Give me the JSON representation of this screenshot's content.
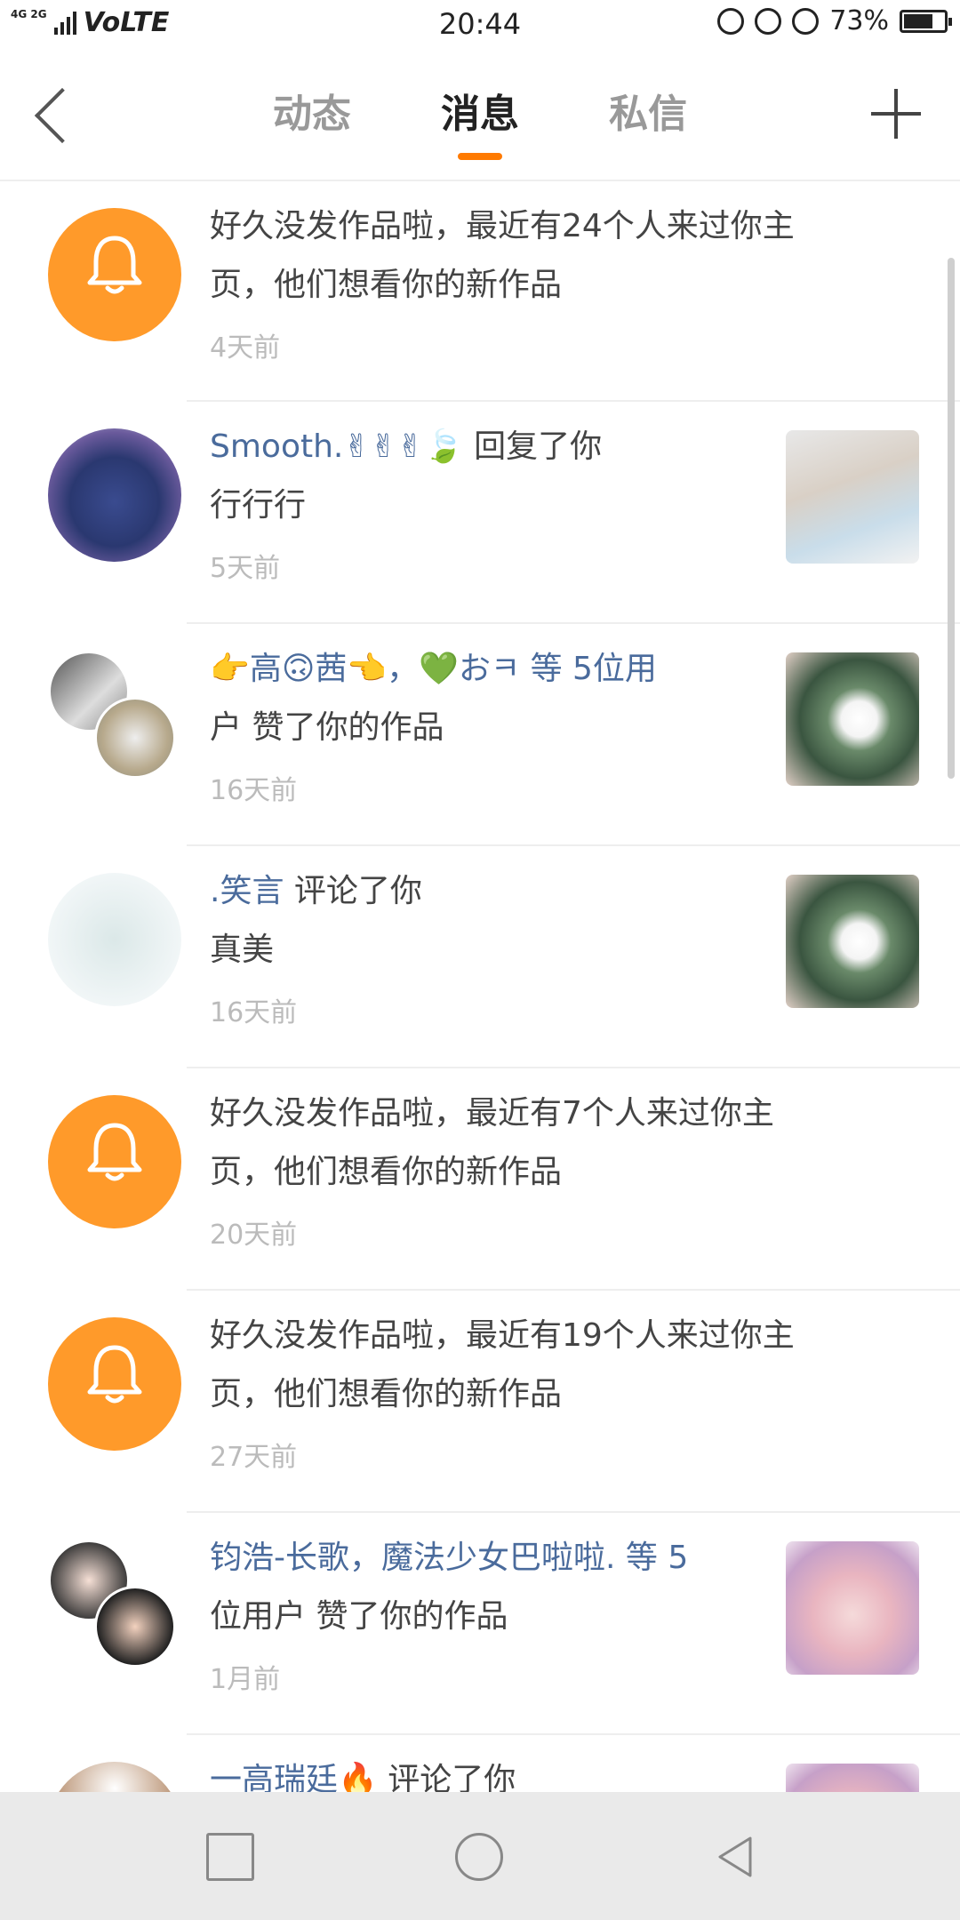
{
  "status_bar": {
    "network": "4G 2G",
    "volte": "VoLTE",
    "time": "20:44",
    "battery_text": "73%",
    "battery_level": 0.73
  },
  "header": {
    "tabs": [
      {
        "label": "动态",
        "active": false
      },
      {
        "label": "消息",
        "active": true
      },
      {
        "label": "私信",
        "active": false
      }
    ],
    "accent_color": "#ff7a00"
  },
  "messages": [
    {
      "type": "system",
      "line1": "好久没发作品啦，最近有24个人来过你主",
      "line2": "页，他们想看你的新作品",
      "time": "4天前"
    },
    {
      "type": "reply",
      "name": "Smooth.✌✌✌🍃",
      "action": " 回复了你",
      "line2": "行行行",
      "time": "5天前",
      "thumb": "boy-headphones-photo"
    },
    {
      "type": "like",
      "name": "👉高🙃茜👈，💚おㅋ",
      "action": " 等 5位用",
      "line2": "户 赞了你的作品",
      "time": "16天前",
      "thumb": "white-flowers-photo"
    },
    {
      "type": "comment",
      "name": ".笑言",
      "action": " 评论了你",
      "line2": "真美",
      "time": "16天前",
      "thumb": "white-flowers-photo"
    },
    {
      "type": "system",
      "line1": "好久没发作品啦，最近有7个人来过你主",
      "line2": "页，他们想看你的新作品",
      "time": "20天前"
    },
    {
      "type": "system",
      "line1": "好久没发作品啦，最近有19个人来过你主",
      "line2": "页，他们想看你的新作品",
      "time": "27天前"
    },
    {
      "type": "like",
      "name": "钧浩-长歌，魔法少女巴啦啦.",
      "action": " 等 5",
      "line2": "位用户 赞了你的作品",
      "time": "1月前",
      "thumb": "girl-selfie-photo"
    },
    {
      "type": "comment",
      "name": "一高瑞廷🔥",
      "action": " 评论了你",
      "line2": "",
      "time": "",
      "thumb": "girl-selfie-photo"
    }
  ],
  "icons": {
    "bell": "bell-icon",
    "back": "back-arrow-icon",
    "add": "plus-icon"
  },
  "colors": {
    "bell_bg": "#ff9a2a",
    "name": "#4a6b9c",
    "time": "#bbbbbb"
  }
}
